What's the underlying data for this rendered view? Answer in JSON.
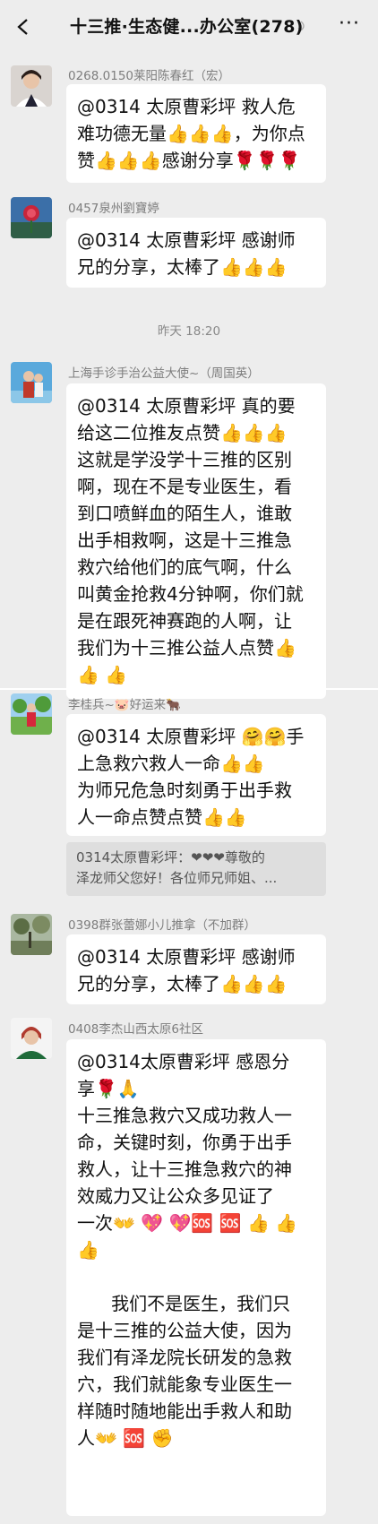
{
  "header": {
    "title": "十三推·生态健...办公室(278)"
  },
  "time_separator": "昨天 18:20",
  "messages": [
    {
      "sender": "0268.0150莱阳陈春红（宏）",
      "lines": [
        "@0314 太原曹彩坪  救人危",
        "难功德无量👍👍👍，为你点",
        "赞👍👍👍感谢分享🌹🌹🌹"
      ]
    },
    {
      "sender": "0457泉州劉寶婷",
      "lines": [
        "@0314 太原曹彩坪  感谢师",
        "兄的分享，太棒了👍👍👍"
      ]
    },
    {
      "sender": "上海手诊手治公益大使~（周国英）",
      "lines": [
        "@0314 太原曹彩坪  真的要",
        "给这二位推友点赞👍👍👍",
        "这就是学没学十三推的区别",
        "啊，现在不是专业医生，看",
        "到口喷鲜血的陌生人，谁敢",
        "出手相救啊，这是十三推急",
        "救穴给他们的底气啊，什么",
        "叫黄金抢救4分钟啊，你们就",
        "是在跟死神赛跑的人啊，让",
        "我们为十三推公益人点赞👍",
        "👍 👍"
      ]
    },
    {
      "sender": "李桂兵~🐷好运来🐂",
      "lines": [
        "@0314 太原曹彩坪  🤗🤗手",
        "上急救穴救人一命👍👍",
        "为师兄危急时刻勇于出手救",
        "人一命点赞点赞👍👍"
      ],
      "quote": [
        "0314太原曹彩坪：❤❤❤尊敬的",
        "泽龙师父您好！各位师兄师姐、..."
      ]
    },
    {
      "sender": "0398群张蕾娜小儿推拿（不加群）",
      "lines": [
        "@0314 太原曹彩坪  感谢师",
        "兄的分享，太棒了👍👍👍"
      ]
    },
    {
      "sender": "0408李杰山西太原6社区",
      "lines": [
        "@0314太原曹彩坪 感恩分",
        "享🌹🙏",
        "十三推急救穴又成功救人一",
        "命，关键时刻，你勇于出手",
        "救人，让十三推急救穴的神",
        "效威力又让公众多见证了",
        "一次👐 💖 💖🆘 🆘 👍 👍",
        "👍",
        "",
        "      我们不是医生，我们只",
        "是十三推的公益大使，因为",
        "我们有泽龙院长研发的急救",
        "穴，我们就能象专业医生一",
        "样随时随地能出手救人和助",
        "人👐 🆘 ✊"
      ]
    }
  ]
}
